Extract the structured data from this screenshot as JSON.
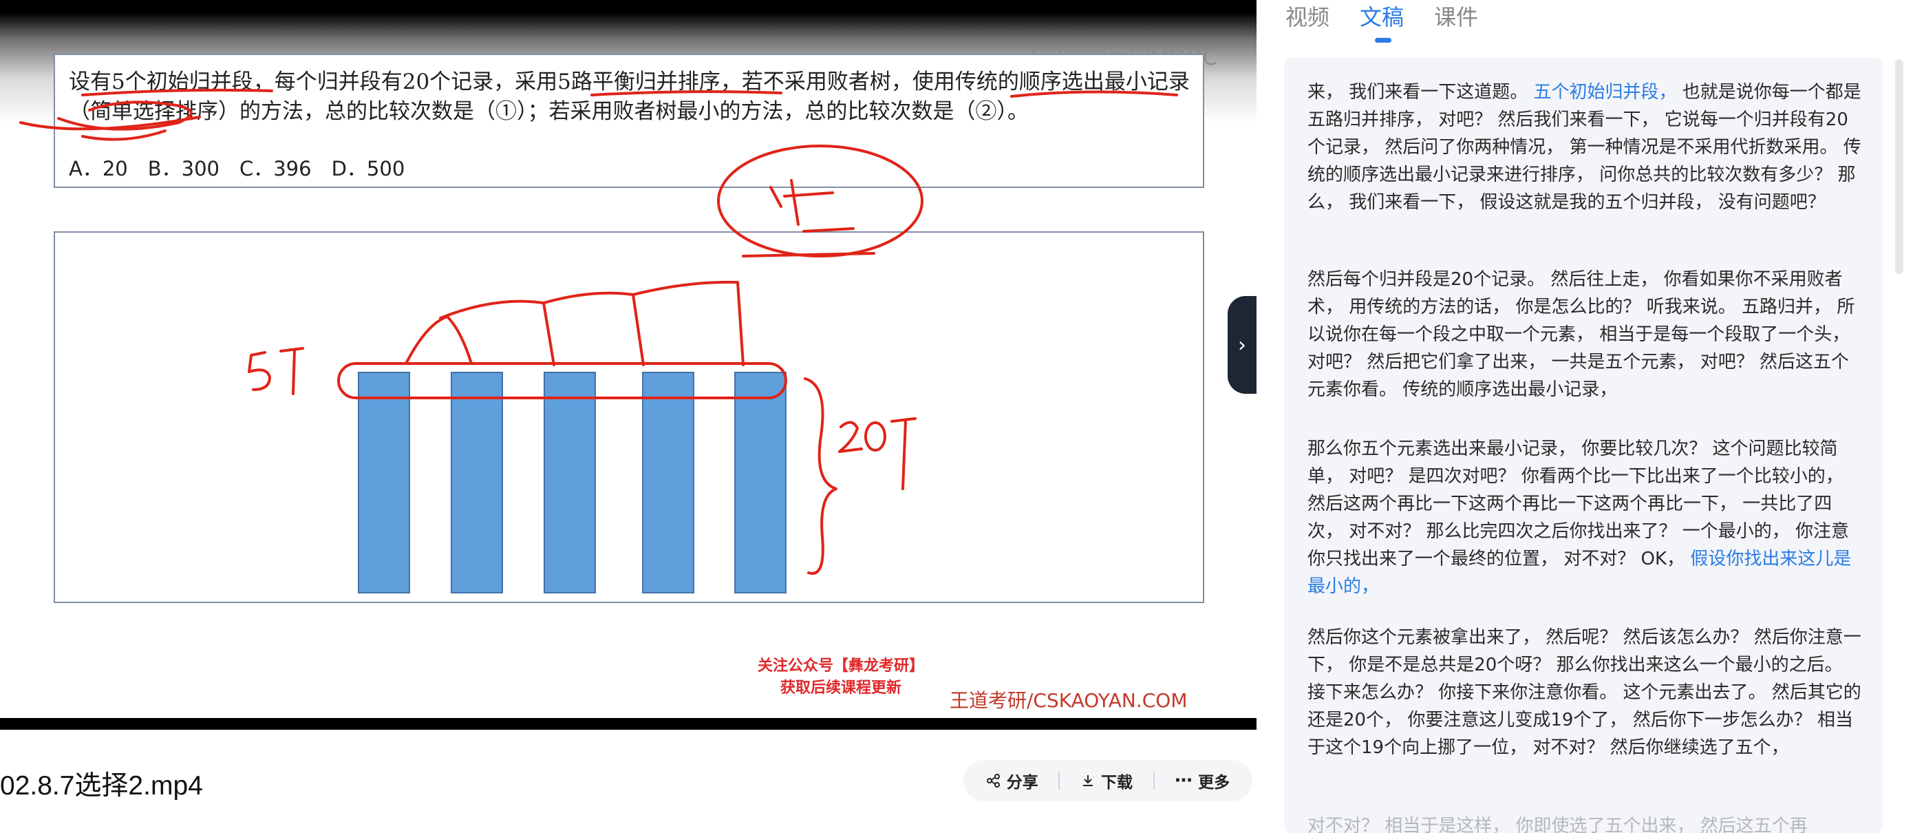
{
  "video": {
    "watermark": "中国大学MOOC",
    "question_text": "设有5个初始归并段，每个归并段有20个记录，采用5路平衡归并排序，若不采用败者树，使用传统的顺序选出最小记录（简单选择排序）的方法，总的比较次数是（①）；若采用败者树最小的方法，总的比较次数是（②）。",
    "options": "A．20　B．300　C．396　D．500",
    "annotations": {
      "runs": "5个",
      "records": "20个",
      "circled": "4次"
    },
    "promo_line1": "关注公众号【彝龙考研】",
    "promo_line2": "获取后续课程更新",
    "brand": "王道考研/CSKAOYAN.COM",
    "bar_count": 5,
    "colors": {
      "bar": "#5f9fdb",
      "ink": "#e02418"
    }
  },
  "filename": "02.8.7选择2.mp4",
  "actions": {
    "share": "分享",
    "download": "下载",
    "more": "更多"
  },
  "collapse_icon": "chevron-right-icon",
  "panel": {
    "tabs": [
      {
        "label": "视频",
        "active": false
      },
      {
        "label": "文稿",
        "active": true
      },
      {
        "label": "课件",
        "active": false
      }
    ],
    "paragraphs": [
      {
        "pre": "来， 我们来看一下这道题。 ",
        "hl": "五个初始归并段，",
        "post": " 也就是说你每一个都是五路归并排序， 对吧？ 然后我们来看一下， 它说每一个归并段有20个记录， 然后问了你两种情况， 第一种情况是不采用代折数采用。 传统的顺序选出最小记录来进行排序， 问你总共的比较次数有多少？ 那么， 我们来看一下， 假设这就是我的五个归并段， 没有问题吧？"
      },
      {
        "pre": "然后每个归并段是20个记录。 然后往上走， 你看如果你不采用败者术， 用传统的方法的话， 你是怎么比的？ 听我来说。 五路归并， 所以说你在每一个段之中取一个元素， 相当于是每一个段取了一个头， 对吧？ 然后把它们拿了出来， 一共是五个元素， 对吧？ 然后这五个元素你看。 传统的顺序选出最小记录，",
        "hl": "",
        "post": ""
      },
      {
        "pre": "那么你五个元素选出来最小记录， 你要比较几次？ 这个问题比较简单， 对吧？ 是四次对吧？ 你看两个比一下比出来了一个比较小的， 然后这两个再比一下这两个再比一下这两个再比一下， 一共比了四次， 对不对？ 那么比完四次之后你找出来了？ 一个最小的， 你注意你只找出来了一个最终的位置， 对不对？ OK， ",
        "hl": "假设你找出来这儿是最小的，",
        "post": ""
      },
      {
        "pre": "然后你这个元素被拿出来了， 然后呢？ 然后该怎么办？ 然后你注意一下， 你是不是总共是20个呀？ 那么你找出来这么一个最小的之后。 接下来怎么办？ 你接下来你注意你看。 这个元素出去了。 然后其它的还是20个， 你要注意这儿变成19个了， 然后你下一步怎么办？ 相当于这个19个向上挪了一位， 对不对？ 然后你继续选了五个，",
        "hl": "",
        "post": ""
      },
      {
        "pre": "对不对？ 相当于是这样， 你即使选了五个出来， 然后这五个再",
        "hl": "",
        "post": ""
      }
    ]
  }
}
